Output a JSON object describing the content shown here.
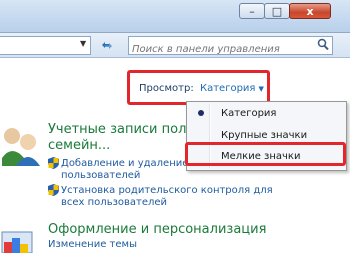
{
  "window": {
    "minimize_glyph": "–",
    "maximize_glyph": "□",
    "close_glyph": "x"
  },
  "address": {
    "search_placeholder": "Поиск в панели управления"
  },
  "view": {
    "label": "Просмотр:",
    "value": "Категория"
  },
  "view_menu": {
    "items": [
      {
        "label": "Категория",
        "selected": true
      },
      {
        "label": "Крупные значки",
        "selected": false
      },
      {
        "label": "Мелкие значки",
        "selected": false
      }
    ]
  },
  "sections": [
    {
      "title_line1": "Учетные записи пользо",
      "title_line2": "семейн...",
      "icon": "users-icon",
      "links": [
        {
          "line1": "Добавление и удаление уч...",
          "line2": "пользователей"
        },
        {
          "line1": "Установка родительского контроля для",
          "line2": "всех пользователей"
        }
      ]
    },
    {
      "title_line1": "Оформление и персонализация",
      "icon": "appearance-icon",
      "links": [
        {
          "line1": "Изменение темы"
        }
      ]
    }
  ],
  "colors": {
    "highlight_red": "#e3262b",
    "link_blue": "#1f5a9e",
    "section_green": "#1a7a3a"
  }
}
